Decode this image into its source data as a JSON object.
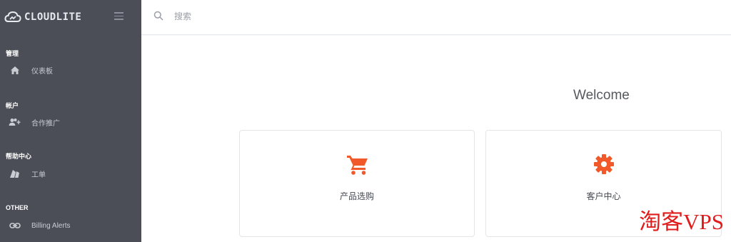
{
  "brand": {
    "name": "CLOUDLITE",
    "logo_icon": "cloud-logo-icon"
  },
  "topbar": {
    "search_placeholder": "搜索"
  },
  "sidebar": {
    "sections": [
      {
        "title": "管理",
        "items": [
          {
            "label": "仪表板",
            "icon": "home-icon"
          }
        ]
      },
      {
        "title": "帐户",
        "items": [
          {
            "label": "合作推广",
            "icon": "add-users-icon"
          }
        ]
      },
      {
        "title": "帮助中心",
        "items": [
          {
            "label": "工单",
            "icon": "ticket-icon"
          }
        ]
      },
      {
        "title": "OTHER",
        "items": [
          {
            "label": "Billing Alerts",
            "icon": "link-icon"
          }
        ]
      }
    ]
  },
  "main": {
    "welcome": "Welcome",
    "cards": [
      {
        "label": "产品选购",
        "icon": "shopping-cart-icon"
      },
      {
        "label": "客户中心",
        "icon": "gear-icon"
      }
    ]
  },
  "watermark": "淘客VPS",
  "colors": {
    "sidebar_bg": "#4b4e57",
    "accent": "#f1592a"
  }
}
